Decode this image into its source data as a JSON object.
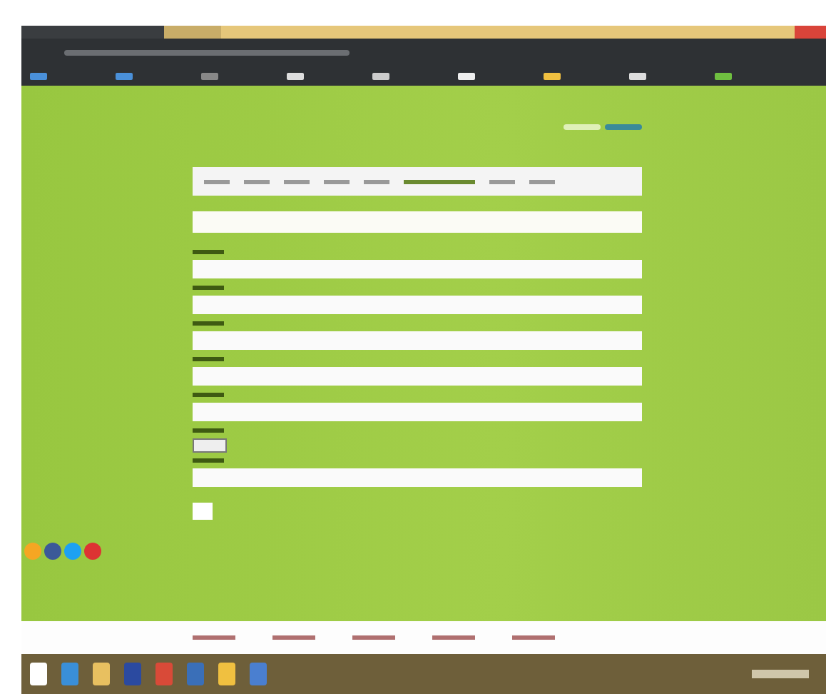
{
  "browser": {
    "tabs": [
      {
        "selected": true
      },
      {
        "selected": false
      }
    ],
    "bookmarks": [
      {
        "color": "#4a90d9"
      },
      {
        "color": "#4a90d9"
      },
      {
        "color": "#888888"
      },
      {
        "color": "#dddddd"
      },
      {
        "color": "#cccccc"
      },
      {
        "color": "#eeeeee"
      },
      {
        "color": "#f0c040"
      },
      {
        "color": "#dddddd"
      },
      {
        "color": "#6fbf40"
      }
    ]
  },
  "page": {
    "nav": [
      {
        "selected": false
      },
      {
        "selected": false
      },
      {
        "selected": false
      },
      {
        "selected": false
      },
      {
        "selected": false
      },
      {
        "selected": true
      },
      {
        "selected": false
      },
      {
        "selected": false
      }
    ],
    "fields": [
      {
        "kind": "text"
      },
      {
        "kind": "text"
      },
      {
        "kind": "text"
      },
      {
        "kind": "text"
      },
      {
        "kind": "text"
      },
      {
        "kind": "file"
      },
      {
        "kind": "text"
      }
    ],
    "social": [
      {
        "color": "#f5a623"
      },
      {
        "color": "#3b5998"
      },
      {
        "color": "#1da1f2"
      },
      {
        "color": "#dd3333"
      }
    ],
    "languages": [
      {
        "selected": false
      },
      {
        "selected": true
      }
    ]
  },
  "taskbar": {
    "apps": [
      {
        "color": "#ffffff"
      },
      {
        "color": "#3a8fd8"
      },
      {
        "color": "#e8c060"
      },
      {
        "color": "#2b4aa0"
      },
      {
        "color": "#d94a38"
      },
      {
        "color": "#3a6fb8"
      },
      {
        "color": "#f0c040"
      },
      {
        "color": "#4a7fd0"
      }
    ]
  }
}
